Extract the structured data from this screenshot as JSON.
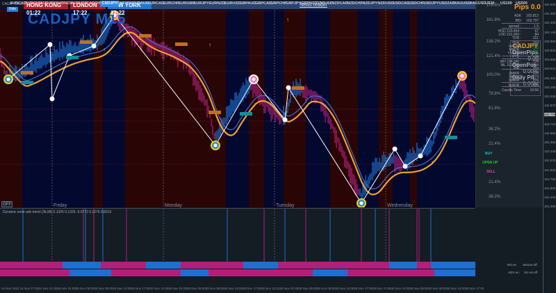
{
  "window": {
    "symbol_tab": "CADJPY,M15",
    "chart_title": "CADJPY M15",
    "hide_label": "Hide",
    "off_label": "OFF"
  },
  "sessions": [
    {
      "label": "HONG KONG  01:22",
      "color": "#b41e28"
    },
    {
      "label": "LONDON   17:22",
      "color": "#b41e28"
    },
    {
      "label": "NEW YORK  12:22",
      "color": "#1e78d2"
    }
  ],
  "news_reader": "News reader",
  "days": [
    "Friday",
    "Monday",
    "Tuesday",
    "Wednesday"
  ],
  "price_axis": [
    "104.625",
    "104.460",
    "104.305",
    "104.145",
    "103.985",
    "103.825",
    "103.665",
    "103.510",
    "103.350",
    "103.190",
    "103.030",
    "102.870",
    "102.793",
    "102.710",
    "102.555",
    "102.395",
    "102.235",
    "102.075",
    "101.920",
    "101.760",
    "101.600",
    "101.440",
    "101.280"
  ],
  "fib_levels": [
    "178.6%",
    "161.8%",
    "138.2%",
    "121.4%",
    "100.0%",
    "78.6%",
    "61.8%",
    "38.2%",
    "21.4%",
    "21.4%",
    "38.2%"
  ],
  "stats": {
    "pips": "Pips 0.0",
    "rows": [
      [
        "ASK",
        "102.812"
      ],
      [
        "BID",
        "102.797"
      ],
      [
        "spread :",
        "1.5"
      ],
      [
        "HOD 103.464 :",
        "67"
      ],
      [
        "LOD 101.953 :",
        "84"
      ],
      [
        "TDR :",
        "151"
      ],
      [
        "YDR :",
        "193"
      ],
      [
        "WADR :",
        "185"
      ],
      [
        "MADR :",
        "127"
      ],
      [
        "YYADR :",
        "125"
      ],
      [
        "PTD :",
        "76"
      ],
      [
        "WH 104.040 :",
        "124"
      ],
      [
        "WL 101.558 :",
        "144"
      ],
      [
        "WR :",
        "268"
      ],
      [
        "1MWR :",
        "226"
      ],
      [
        "3MWR :",
        "273"
      ],
      [
        "6MWR :",
        "276"
      ],
      [
        "3xADR :",
        "434"
      ],
      [
        "Candle Time",
        "10:56"
      ]
    ]
  },
  "signals": {
    "buy": "BUY",
    "open_up": "OPEN UP",
    "sell": "SELL"
  },
  "position_box": {
    "symbol": "CADJPY",
    "open_pips_label": "OpenPips",
    "open_pips": "0.00",
    "open_pos_label": "OpenPos",
    "open_pos": "0.00%",
    "daily_pl_label": "Daily P/L",
    "daily_pl": "0.00%"
  },
  "indicator": {
    "label": "Dynamic zone adx trend (36,98) 0.1325 0.1325 -0.0772 0.1276 0.8319",
    "strip1": [
      "Rsi-on",
      "Sema4-off"
    ],
    "strip2": [
      "ADX-on",
      "XU-v4-off"
    ]
  },
  "symbols": [
    "AUDCAD",
    "AUDCHF",
    "AUDJPY",
    "AUDNZD",
    "AUDUSD",
    "CADCHF",
    "CADJPY",
    "CHFJPY",
    "EURAUD",
    "EURCAD",
    "EURCHF",
    "EURGBP",
    "EURJPY",
    "EURNZD",
    "EURUSD",
    "GBPAUD",
    "GBPCAD",
    "GBPCHF",
    "GBPJPY",
    "GBPNZD",
    "GBPUSD",
    "NZDCAD",
    "NZDCHF",
    "NZDJPY",
    "NZDUSD",
    "USDCAD",
    "USDCHF",
    "USDJPY",
    "USDZAR",
    "XAUUSD",
    "XAGUSD",
    "US30",
    "US100",
    "US500"
  ],
  "active_symbol": "CADJPY",
  "dates": [
    "24 Nov 2022",
    "24 Nov 17:00",
    "24 Nov 21:00",
    "25 Nov 01:00",
    "25 Nov 05:00",
    "25 Nov 09:00",
    "25 Nov 13:00",
    "25 Nov 17:00",
    "25 Nov 21:00",
    "28 Nov 01:00",
    "28 Nov 05:00",
    "28 Nov 09:00",
    "28 Nov 13:00",
    "28 Nov 17:00",
    "28 Nov 21:00",
    "29 Nov 01:00",
    "29 Nov 05:00",
    "29 Nov 09:00",
    "29 Nov 13:00",
    "29 Nov 17:00",
    "29 Nov 21:00",
    "30 Nov 01:00",
    "30 Nov 05:00",
    "30 Nov 09:00",
    "30 Nov 13:00",
    "30 Nov 17:00"
  ],
  "colors": {
    "bull": "#1e6fd0",
    "bear": "#b0207a",
    "band": "#f0a030",
    "zigzag": "#ffffff",
    "session_red": "#2a0505",
    "session_blue": "#03082e",
    "buy": "#22b8d8",
    "open_up": "#22cc22",
    "sell": "#e040a0",
    "accent": "#f0a020"
  }
}
